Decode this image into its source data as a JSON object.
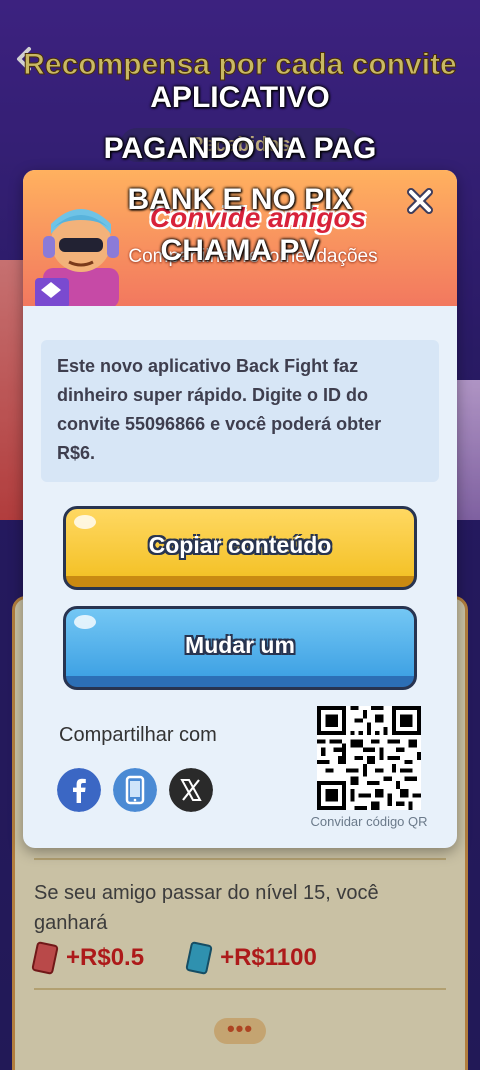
{
  "background": {
    "title": "Recompensa por cada convite",
    "subtitle": "Recebidos",
    "info_text": "Se seu amigo passar do nível 15, você ganhará",
    "reward_1": "+R$0.5",
    "reward_2": "+R$1100",
    "more_label": "•••"
  },
  "modal": {
    "title": "Convide amigos",
    "subtitle": "Compartilhar recomendações",
    "message": "Este novo aplicativo Back Fight faz dinheiro super rápido. Digite o ID do convite 55096866 e você poderá obter R$6.",
    "copy_button": "Copiar conteúdo",
    "change_button": "Mudar um",
    "share_label": "Compartilhar com",
    "share_targets": [
      "facebook-icon",
      "phone-icon",
      "x-icon"
    ],
    "qr_label": "Convidar código QR"
  },
  "caption": {
    "line1": "APLICATIVO",
    "line2": "PAGANDO NA PAG",
    "line3": "BANK E NO PIX",
    "line4": "CHAMA PV"
  },
  "colors": {
    "yellow_button": "#f4c228",
    "blue_button": "#3fa2e4",
    "header_orange": "#f2785f",
    "title_red": "#d8223a"
  }
}
